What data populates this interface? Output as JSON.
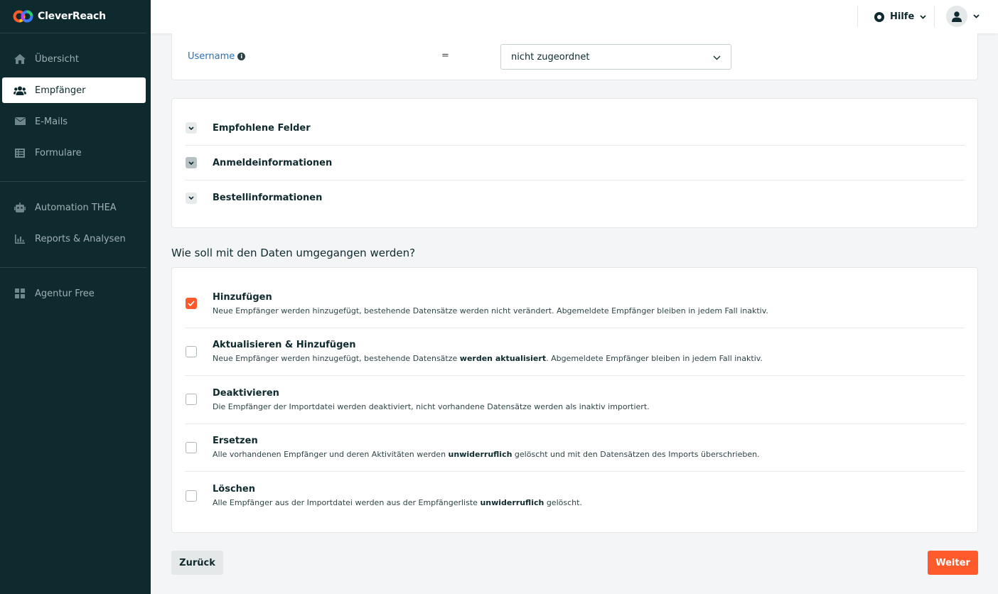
{
  "app": {
    "name": "CleverReach"
  },
  "sidebar": {
    "groups": [
      [
        {
          "label": "Übersicht",
          "icon": "home-icon"
        },
        {
          "label": "Empfänger",
          "icon": "users-icon",
          "active": true
        },
        {
          "label": "E-Mails",
          "icon": "envelope-icon"
        },
        {
          "label": "Formulare",
          "icon": "form-icon"
        }
      ],
      [
        {
          "label": "Automation THEA",
          "icon": "robot-icon"
        },
        {
          "label": "Reports & Analysen",
          "icon": "chart-icon"
        }
      ],
      [
        {
          "label": "Agentur Free",
          "icon": "grid-icon"
        }
      ]
    ]
  },
  "topbar": {
    "help_label": "Hilfe"
  },
  "mapping": {
    "field_label": "Username",
    "operator": "=",
    "selected_value": "nicht zugeordnet"
  },
  "accordion": {
    "items": [
      {
        "title": "Empfohlene Felder"
      },
      {
        "title": "Anmeldeinformationen"
      },
      {
        "title": "Bestellinformationen"
      }
    ]
  },
  "data_handling": {
    "question": "Wie soll mit den Daten umgegangen werden?",
    "options": [
      {
        "title": "Hinzufügen",
        "checked": true,
        "desc_before": "Neue Empfänger werden hinzugefügt, bestehende Datensätze werden nicht verändert. Abgemeldete Empfänger bleiben in jedem Fall inaktiv.",
        "desc_bold": "",
        "desc_after": ""
      },
      {
        "title": "Aktualisieren & Hinzufügen",
        "checked": false,
        "desc_before": "Neue Empfänger werden hinzugefügt, bestehende Datensätze ",
        "desc_bold": "werden aktualisiert",
        "desc_after": ". Abgemeldete Empfänger bleiben in jedem Fall inaktiv."
      },
      {
        "title": "Deaktivieren",
        "checked": false,
        "desc_before": "Die Empfänger der Importdatei werden deaktiviert, nicht vorhandene Datensätze werden als inaktiv importiert.",
        "desc_bold": "",
        "desc_after": ""
      },
      {
        "title": "Ersetzen",
        "checked": false,
        "desc_before": "Alle vorhandenen Empfänger und deren Aktivitäten werden ",
        "desc_bold": "unwiderruflich",
        "desc_after": " gelöscht und mit den Datensätzen des Imports überschrieben."
      },
      {
        "title": "Löschen",
        "checked": false,
        "desc_before": "Alle Empfänger aus der Importdatei werden aus der Empfängerliste ",
        "desc_bold": "unwiderruflich",
        "desc_after": " gelöscht."
      }
    ]
  },
  "footer": {
    "back_label": "Zurück",
    "next_label": "Weiter"
  },
  "colors": {
    "sidebar_bg": "#0f2a2e",
    "accent": "#ff5a2b",
    "link": "#2b6fb8"
  }
}
